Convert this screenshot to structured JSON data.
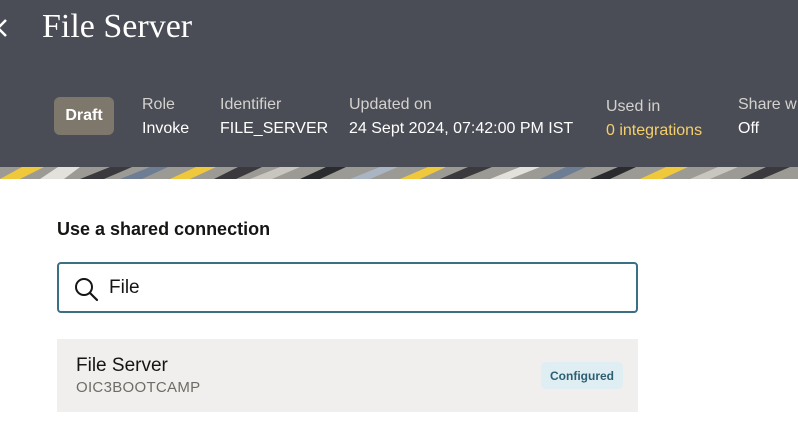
{
  "header": {
    "title": "File Server",
    "status_badge": "Draft",
    "meta": [
      {
        "label": "Role",
        "value": "Invoke"
      },
      {
        "label": "Identifier",
        "value": "FILE_SERVER"
      },
      {
        "label": "Updated on",
        "value": "24 Sept 2024, 07:42:00 PM IST"
      },
      {
        "label": "Used in",
        "value": "0 integrations"
      },
      {
        "label": "Share w",
        "value": "Off"
      }
    ]
  },
  "main": {
    "section_title": "Use a shared connection",
    "search": {
      "value": "File",
      "placeholder": ""
    },
    "results": [
      {
        "name": "File Server",
        "subtitle": "OIC3BOOTCAMP",
        "status": "Configured"
      }
    ]
  },
  "colors": {
    "header_bg": "#4a4d55",
    "badge_bg": "#7e776c",
    "link": "#f5cf6b",
    "search_border": "#3a6f84",
    "result_bg": "#f1efed",
    "status_bg": "#dfeef3",
    "status_text": "#2d5f72"
  },
  "icons": {
    "back": "chevron-left-icon",
    "search": "search-icon"
  }
}
